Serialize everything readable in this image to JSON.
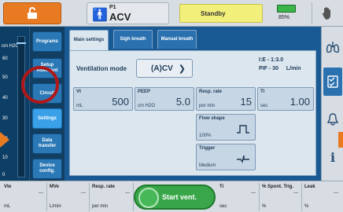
{
  "topbar": {
    "patient_id": "P1",
    "mode": "ACV",
    "status": "Standby",
    "battery_pct": "85%"
  },
  "gauge": {
    "unit": "cm H2O",
    "ticks": [
      "60",
      "50",
      "40",
      "30",
      "20",
      "10",
      "0"
    ]
  },
  "sidemenu": {
    "items": [
      {
        "label": "Programs"
      },
      {
        "label": "Setup Assistant"
      },
      {
        "label": "Circuit"
      },
      {
        "label": "Settings"
      },
      {
        "label": "Data transfer"
      },
      {
        "label": "Device config."
      }
    ]
  },
  "tabs": [
    {
      "label": "Main settings"
    },
    {
      "label": "Sigh breath"
    },
    {
      "label": "Manual breath"
    }
  ],
  "main": {
    "ventilation_mode_label": "Ventilation mode",
    "ventilation_mode_value": "(A)CV",
    "ie_ratio": "I:E - 1:3.0",
    "pif_label": "PIF - 30",
    "pif_unit": "L/min"
  },
  "params": {
    "vt": {
      "name": "Vt",
      "value": "500",
      "unit": "mL"
    },
    "peep": {
      "name": "PEEP",
      "value": "5.0",
      "unit": "cm H2O"
    },
    "resp_rate": {
      "name": "Resp. rate",
      "value": "15",
      "unit": "per min"
    },
    "ti": {
      "name": "Ti",
      "value": "1.00",
      "unit": "sec"
    },
    "flow_shape": {
      "name": "Flow shape",
      "value": "100%"
    },
    "trigger": {
      "name": "Trigger",
      "value": "Medium"
    }
  },
  "bottom": {
    "measurements": [
      {
        "name": "Vte",
        "value": "---",
        "unit": "mL"
      },
      {
        "name": "MVe",
        "value": "---",
        "unit": "L/min"
      },
      {
        "name": "Resp. rate",
        "value": "---",
        "unit": "per min"
      },
      {
        "name": "Ti",
        "value": "---",
        "unit": "sec"
      },
      {
        "name": "% Spont. Trig.",
        "value": "---",
        "unit": "%"
      },
      {
        "name": "Leak",
        "value": "---",
        "unit": "%"
      }
    ],
    "start_label": "Start vent."
  },
  "colors": {
    "accent_orange": "#e87a22",
    "standby_yellow": "#f2f07a",
    "start_green": "#3aa64a",
    "circle_red": "#b01818"
  }
}
